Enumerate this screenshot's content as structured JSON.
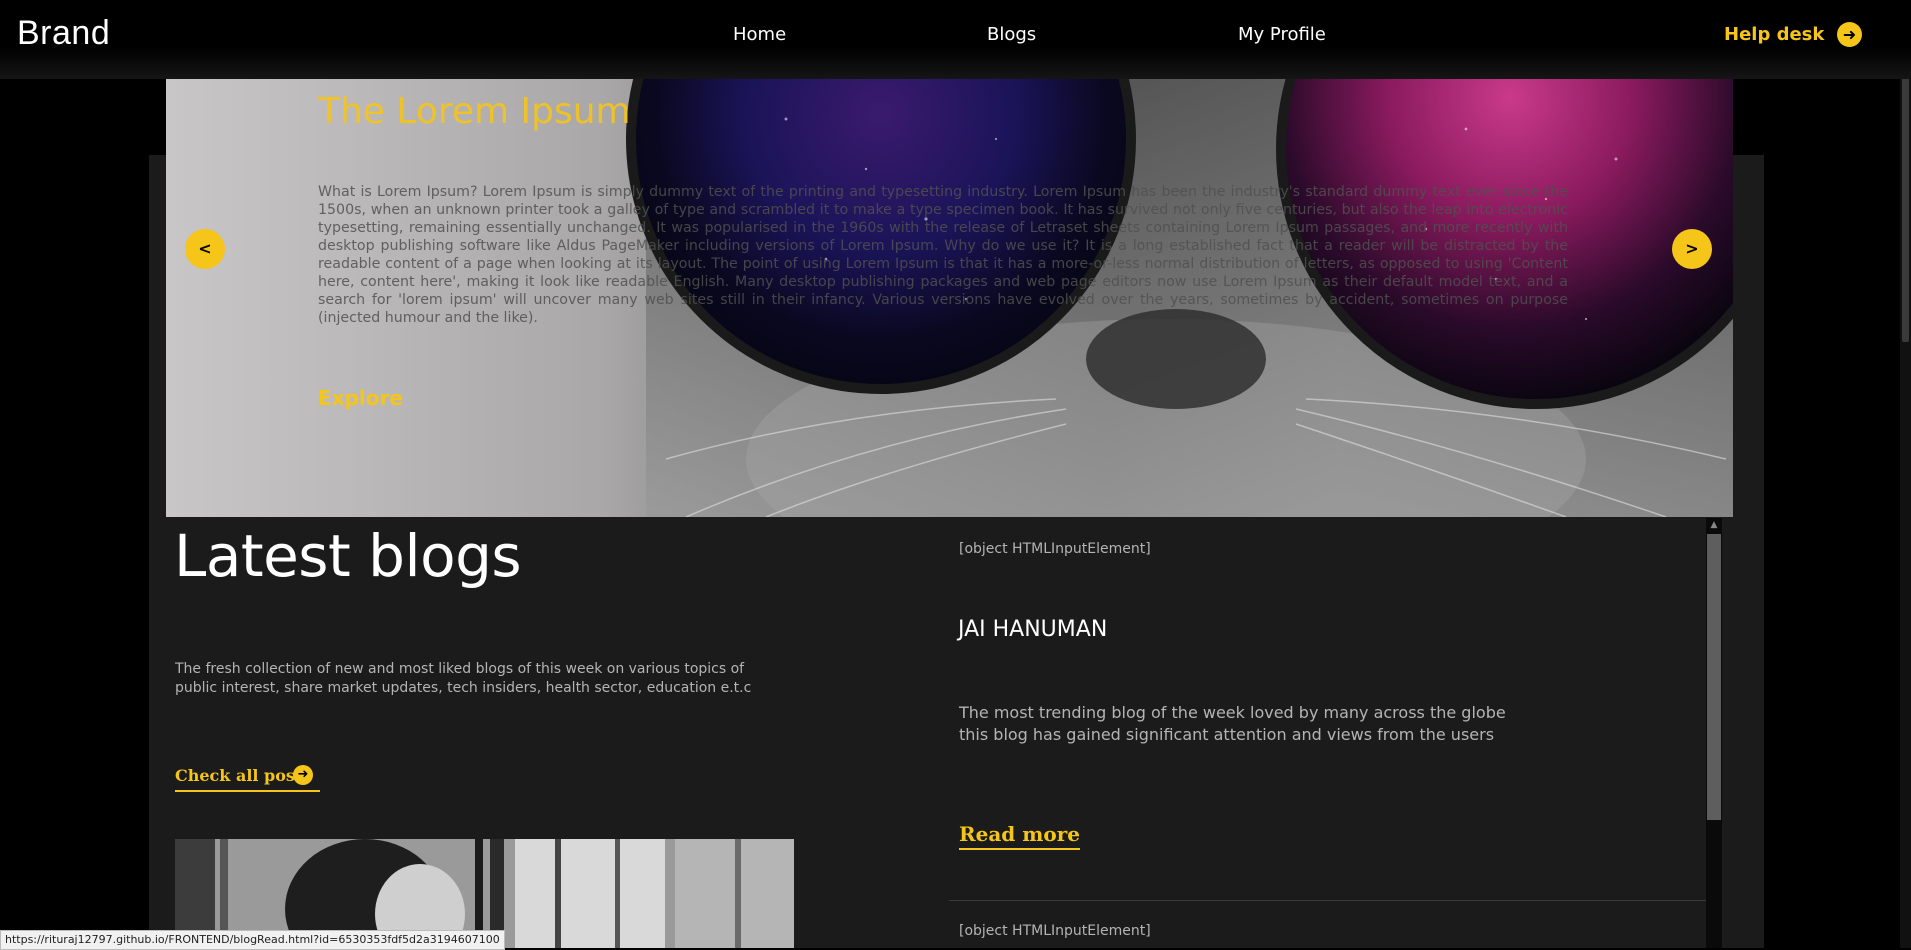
{
  "navbar": {
    "brand": "Brand",
    "links": [
      "Home",
      "Blogs",
      "My Profile"
    ],
    "helpdesk": "Help desk"
  },
  "hero": {
    "title": "The Lorem Ipsum",
    "text": "What is Lorem Ipsum? Lorem Ipsum is simply dummy text of the printing and typesetting industry. Lorem Ipsum has been the industry's standard dummy text ever since the 1500s, when an unknown printer took a galley of type and scrambled it to make a type specimen book. It has survived not only five centuries, but also the leap into electronic typesetting, remaining essentially unchanged. It was popularised in the 1960s with the release of Letraset sheets containing Lorem Ipsum passages, and more recently with desktop publishing software like Aldus PageMaker including versions of Lorem Ipsum. Why do we use it? It is a long established fact that a reader will be distracted by the readable content of a page when looking at its layout. The point of using Lorem Ipsum is that it has a more-or-less normal distribution of letters, as opposed to using 'Content here, content here', making it look like readable English. Many desktop publishing packages and web page editors now use Lorem Ipsum as their default model text, and a search for 'lorem ipsum' will uncover many web sites still in their infancy. Various versions have evolved over the years, sometimes by accident, sometimes on purpose (injected humour and the like).",
    "explore": "Explore",
    "prev": "<",
    "next": ">"
  },
  "latest": {
    "title": "Latest blogs",
    "description": "The fresh collection of new and most liked blogs of this week on various topics of public interest, share market updates, tech insiders, health sector, education e.t.c",
    "check_all": "Check all post"
  },
  "posts": [
    {
      "meta": "[object HTMLInputElement]",
      "title": "JAI HANUMAN",
      "description": "The most trending blog of the week loved by many across the globe this blog has gained significant attention and views from the users",
      "read_more": "Read more"
    },
    {
      "meta": "[object HTMLInputElement]"
    }
  ],
  "status_url": "https://rituraj12797.github.io/FRONTEND/blogRead.html?id=6530353fdf5d2a3194607100",
  "colors": {
    "accent": "#f6c519",
    "panel": "#1b1b1b",
    "background": "#000000"
  }
}
